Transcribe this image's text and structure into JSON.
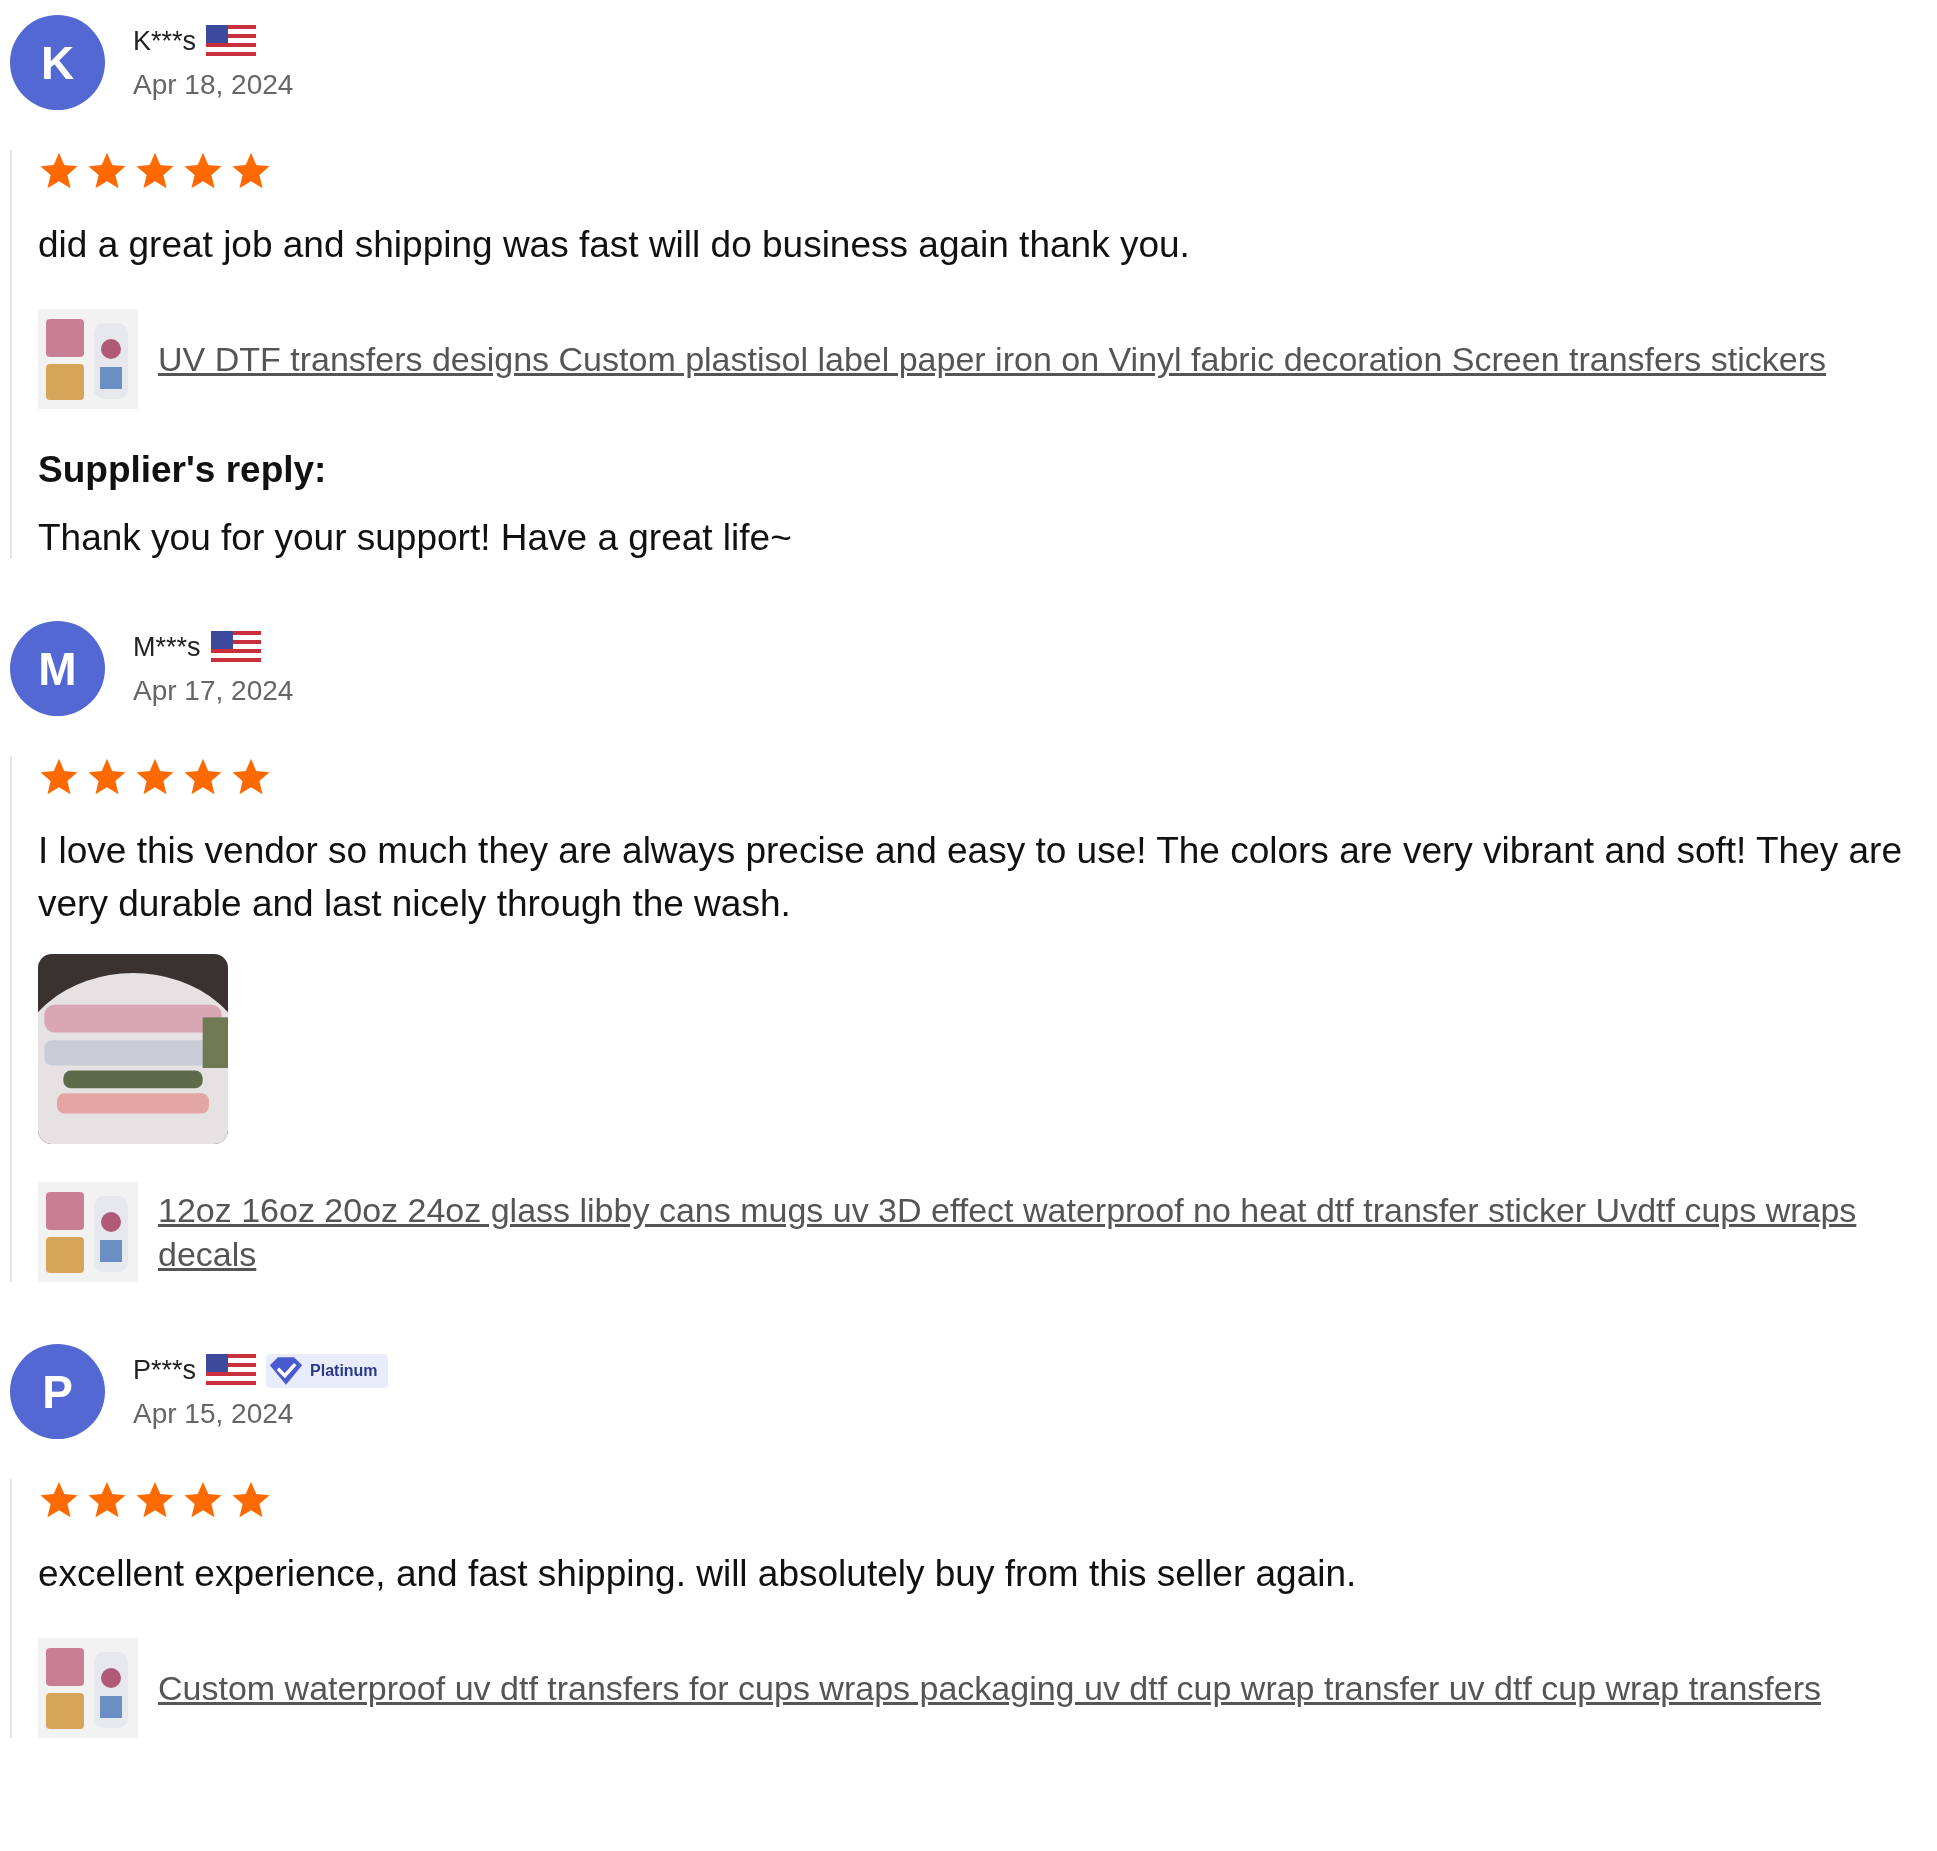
{
  "reviews": [
    {
      "initial": "K",
      "name": "K***s",
      "date": "Apr 18, 2024",
      "stars": 5,
      "text": "did a great job and shipping was fast will do business again thank you.",
      "product": {
        "title": "UV DTF transfers designs Custom plastisol label paper iron on Vinyl fabric decoration Screen transfers stickers"
      },
      "reply": {
        "label": "Supplier's reply:",
        "text": "Thank you for your support! Have a great life~"
      }
    },
    {
      "initial": "M",
      "name": "M***s",
      "date": "Apr 17, 2024",
      "stars": 5,
      "text": "I love this vendor so much they are always precise and easy to use! The colors are very vibrant and soft! They are very durable and last nicely through the wash.",
      "photos": [
        {
          "kind": "picture"
        }
      ],
      "product": {
        "title": "12oz 16oz 20oz 24oz glass libby cans mugs uv 3D effect waterproof no heat dtf transfer sticker Uvdtf cups wraps decals"
      }
    },
    {
      "initial": "P",
      "name": "P***s",
      "badge": "Platinum",
      "date": "Apr 15, 2024",
      "stars": 5,
      "text": "excellent experience, and fast shipping. will absolutely buy from this seller again.",
      "product": {
        "title": "Custom waterproof uv dtf transfers for cups wraps packaging uv dtf cup wrap transfer uv dtf cup wrap transfers"
      }
    }
  ]
}
